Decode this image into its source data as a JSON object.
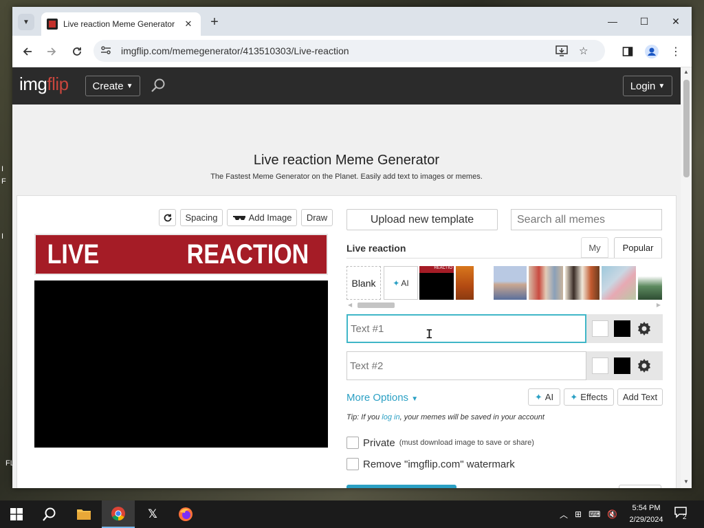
{
  "desktop": {
    "side_labels": [
      "I",
      "F",
      "I",
      "FL"
    ]
  },
  "browser": {
    "tab": {
      "title": "Live reaction Meme Generator"
    },
    "url": "imgflip.com/memegenerator/413510303/Live-reaction"
  },
  "site": {
    "logo_left": "img",
    "logo_right": "flip",
    "create_label": "Create",
    "login_label": "Login"
  },
  "page": {
    "title": "Live reaction Meme Generator",
    "subtitle": "The Fastest Meme Generator on the Planet. Easily add text to images or memes."
  },
  "editor": {
    "spacing_label": "Spacing",
    "add_image_label": "Add Image",
    "draw_label": "Draw",
    "meme_text_left": "LIVE",
    "meme_text_right": "REACTION"
  },
  "templates": {
    "upload_label": "Upload new template",
    "search_placeholder": "Search all memes",
    "current_name": "Live reaction",
    "tab_my": "My",
    "tab_popular": "Popular",
    "blank_label": "Blank",
    "ai_label": "AI",
    "thumb_mini_text": "REACTIO"
  },
  "text_boxes": [
    {
      "placeholder": "Text #1",
      "value": ""
    },
    {
      "placeholder": "Text #2",
      "value": ""
    }
  ],
  "options": {
    "more_options_label": "More Options",
    "ai_label": "AI",
    "effects_label": "Effects",
    "add_text_label": "Add Text",
    "tip_prefix": "Tip: If you ",
    "tip_link": "log in",
    "tip_suffix": ", your memes will be saved in your account",
    "private_label": "Private",
    "private_note": "(must download image to save or share)",
    "watermark_label": "Remove \"imgflip.com\" watermark"
  },
  "taskbar": {
    "time": "5:54 PM",
    "date": "2/29/2024",
    "notification_count": "2"
  },
  "colors": {
    "accent": "#2ba0c4",
    "focus_border": "#3fb6c7",
    "meme_red": "#a51c26",
    "header_bg": "#2b2b2b"
  }
}
